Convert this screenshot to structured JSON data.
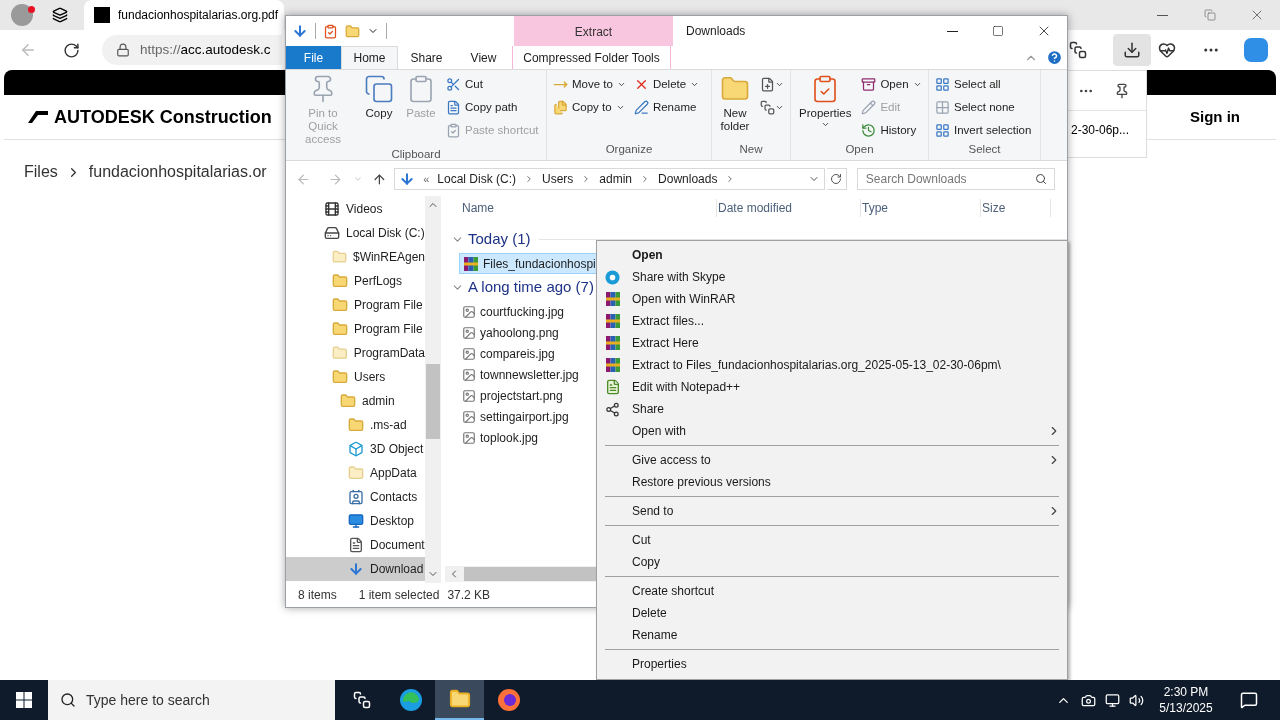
{
  "browser": {
    "tab_title": "fundacionhospitalarias.org.pdf",
    "url_scheme": "https://",
    "url_host": "acc.autodesk.c",
    "logo": "AUTODESK Construction",
    "breadcrumb": [
      "Files",
      "fundacionhospitalarias.or"
    ],
    "downloads_item": "2-30-06p...",
    "sign_in": "Sign in"
  },
  "explorer": {
    "title": "Downloads",
    "context_group": "Extract",
    "tabs": [
      {
        "label": "File",
        "kind": "file",
        "selected": false
      },
      {
        "label": "Home",
        "kind": "tab",
        "selected": true
      },
      {
        "label": "Share",
        "kind": "tab",
        "selected": false
      },
      {
        "label": "View",
        "kind": "tab",
        "selected": false
      },
      {
        "label": "Compressed Folder Tools",
        "kind": "context",
        "selected": false
      }
    ],
    "ribbon": [
      {
        "name": "Clipboard",
        "columns": [
          [
            {
              "label": "Pin to Quick access",
              "kind": "large",
              "disabled": true,
              "dropdown": false
            }
          ],
          [
            {
              "label": "Copy",
              "kind": "large",
              "disabled": false,
              "dropdown": false
            }
          ],
          [
            {
              "label": "Paste",
              "kind": "large",
              "disabled": true,
              "dropdown": false
            }
          ],
          [
            {
              "label": "Cut",
              "kind": "small",
              "disabled": false,
              "dropdown": false
            },
            {
              "label": "Copy path",
              "kind": "small",
              "disabled": false,
              "dropdown": false
            },
            {
              "label": "Paste shortcut",
              "kind": "small",
              "disabled": true,
              "dropdown": false
            }
          ]
        ]
      },
      {
        "name": "Organize",
        "columns": [
          [
            {
              "label": "Move to",
              "kind": "small",
              "disabled": false,
              "dropdown": true
            },
            {
              "label": "Copy to",
              "kind": "small",
              "disabled": false,
              "dropdown": true
            }
          ],
          [
            {
              "label": "Delete",
              "kind": "small",
              "disabled": false,
              "dropdown": true
            },
            {
              "label": "Rename",
              "kind": "small",
              "disabled": false,
              "dropdown": false
            }
          ]
        ]
      },
      {
        "name": "New",
        "columns": [
          [
            {
              "label": "New folder",
              "kind": "large",
              "disabled": false,
              "dropdown": false
            }
          ],
          [
            {
              "kind": "icon",
              "disabled": false,
              "dropdown": true
            },
            {
              "kind": "icon",
              "disabled": false,
              "dropdown": true
            }
          ]
        ]
      },
      {
        "name": "Open",
        "columns": [
          [
            {
              "label": "Properties",
              "kind": "large",
              "disabled": false,
              "dropdown": true
            }
          ],
          [
            {
              "label": "Open",
              "kind": "small",
              "disabled": false,
              "dropdown": true
            },
            {
              "label": "Edit",
              "kind": "small",
              "disabled": true,
              "dropdown": false
            },
            {
              "label": "History",
              "kind": "small",
              "disabled": false,
              "dropdown": false
            }
          ]
        ]
      },
      {
        "name": "Select",
        "columns": [
          [
            {
              "label": "Select all",
              "kind": "small",
              "disabled": false,
              "dropdown": false
            },
            {
              "label": "Select none",
              "kind": "small",
              "disabled": false,
              "dropdown": false
            },
            {
              "label": "Invert selection",
              "kind": "small",
              "disabled": false,
              "dropdown": false
            }
          ]
        ]
      }
    ],
    "address": {
      "overflow": "«",
      "path": [
        "Local Disk (C:)",
        "Users",
        "admin",
        "Downloads"
      ],
      "search_placeholder": "Search Downloads"
    },
    "nav": [
      {
        "label": "Videos",
        "kind": "videos",
        "selected": false
      },
      {
        "label": "Local Disk (C:)",
        "kind": "drive",
        "selected": false,
        "children": [
          {
            "label": "$WinREAgen",
            "kind": "pale",
            "selected": false
          },
          {
            "label": "PerfLogs",
            "kind": "folder",
            "selected": false
          },
          {
            "label": "Program File",
            "kind": "folder",
            "selected": false
          },
          {
            "label": "Program File",
            "kind": "folder",
            "selected": false
          },
          {
            "label": "ProgramData",
            "kind": "pale",
            "selected": false
          },
          {
            "label": "Users",
            "kind": "folder",
            "selected": false,
            "children": [
              {
                "label": "admin",
                "kind": "folder",
                "selected": false,
                "children": [
                  {
                    "label": ".ms-ad",
                    "kind": "folder",
                    "selected": false
                  },
                  {
                    "label": "3D Object",
                    "kind": "cube",
                    "selected": false
                  },
                  {
                    "label": "AppData",
                    "kind": "pale",
                    "selected": false
                  },
                  {
                    "label": "Contacts",
                    "kind": "contacts",
                    "selected": false
                  },
                  {
                    "label": "Desktop",
                    "kind": "desktop",
                    "selected": false
                  },
                  {
                    "label": "Document",
                    "kind": "documents",
                    "selected": false
                  },
                  {
                    "label": "Download",
                    "kind": "downloads",
                    "selected": true
                  }
                ]
              }
            ]
          }
        ]
      }
    ],
    "columns": [
      "Name",
      "Date modified",
      "Type",
      "Size"
    ],
    "groups": [
      {
        "label": "Today (1)",
        "expanded": true,
        "files": [
          {
            "name": "Files_fundacionhospi",
            "kind": "archive",
            "selected": true
          }
        ]
      },
      {
        "label": "A long time ago (7)",
        "expanded": true,
        "files": [
          {
            "name": "courtfucking.jpg",
            "kind": "image",
            "selected": false
          },
          {
            "name": "yahoolong.png",
            "kind": "image",
            "selected": false
          },
          {
            "name": "compareis.jpg",
            "kind": "image",
            "selected": false
          },
          {
            "name": "townnewsletter.jpg",
            "kind": "image",
            "selected": false
          },
          {
            "name": "projectstart.png",
            "kind": "image",
            "selected": false
          },
          {
            "name": "settingairport.jpg",
            "kind": "image",
            "selected": false
          },
          {
            "name": "toplook.jpg",
            "kind": "image",
            "selected": false
          }
        ]
      }
    ],
    "status": {
      "count": "8 items",
      "selection": "1 item selected",
      "size": "37.2 KB"
    }
  },
  "context_menu": [
    {
      "kind": "item",
      "label": "Open",
      "default": true,
      "submenu": false
    },
    {
      "kind": "item",
      "label": "Share with Skype",
      "default": false,
      "submenu": false
    },
    {
      "kind": "item",
      "label": "Open with WinRAR",
      "default": false,
      "submenu": false
    },
    {
      "kind": "item",
      "label": "Extract files...",
      "default": false,
      "submenu": false
    },
    {
      "kind": "item",
      "label": "Extract Here",
      "default": false,
      "submenu": false
    },
    {
      "kind": "item",
      "label": "Extract to Files_fundacionhospitalarias.org_2025-05-13_02-30-06pm\\",
      "default": false,
      "submenu": false
    },
    {
      "kind": "item",
      "label": "Edit with Notepad++",
      "default": false,
      "submenu": false
    },
    {
      "kind": "item",
      "label": "Share",
      "default": false,
      "submenu": false
    },
    {
      "kind": "item",
      "label": "Open with",
      "default": false,
      "submenu": true
    },
    {
      "kind": "separator"
    },
    {
      "kind": "item",
      "label": "Give access to",
      "default": false,
      "submenu": true
    },
    {
      "kind": "item",
      "label": "Restore previous versions",
      "default": false,
      "submenu": false
    },
    {
      "kind": "separator"
    },
    {
      "kind": "item",
      "label": "Send to",
      "default": false,
      "submenu": true
    },
    {
      "kind": "separator"
    },
    {
      "kind": "item",
      "label": "Cut",
      "default": false,
      "submenu": false
    },
    {
      "kind": "item",
      "label": "Copy",
      "default": false,
      "submenu": false
    },
    {
      "kind": "separator"
    },
    {
      "kind": "item",
      "label": "Create shortcut",
      "default": false,
      "submenu": false
    },
    {
      "kind": "item",
      "label": "Delete",
      "default": false,
      "submenu": false
    },
    {
      "kind": "item",
      "label": "Rename",
      "default": false,
      "submenu": false
    },
    {
      "kind": "separator"
    },
    {
      "kind": "item",
      "label": "Properties",
      "default": false,
      "submenu": false
    }
  ],
  "taskbar": {
    "search_placeholder": "Type here to search",
    "apps": [
      {
        "kind": "taskview",
        "selected": false
      },
      {
        "kind": "edge",
        "selected": false
      },
      {
        "kind": "explorer",
        "selected": true
      },
      {
        "kind": "firefox",
        "selected": false
      }
    ],
    "time": "2:30 PM",
    "date": "5/13/2025"
  }
}
